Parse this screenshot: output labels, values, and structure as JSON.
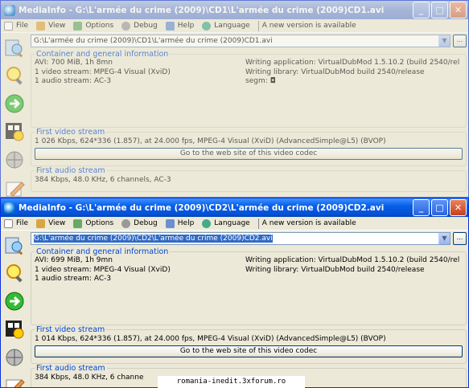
{
  "window1": {
    "title": "MediaInfo - G:\\L'armée du crime (2009)\\CD1\\L'armée du crime (2009)CD1.avi",
    "path": "G:\\L'armée du crime (2009)\\CD1\\L'armée du crime (2009)CD1.avi",
    "general": {
      "legend": "Container and general information",
      "left": [
        "AVI: 700 MiB, 1h 8mn",
        "1 video stream: MPEG-4 Visual (XviD)",
        "1 audio stream: AC-3"
      ],
      "right": [
        "Writing application: VirtualDubMod 1.5.10.2 (build 2540/rel",
        "Writing library: VirtualDubMod build 2540/release",
        "segm: ◘"
      ]
    },
    "video": {
      "legend": "First video stream",
      "line": "1 026 Kbps, 624*336 (1.857), at 24.000 fps, MPEG-4 Visual (XviD) (AdvancedSimple@L5) (BVOP)",
      "button": "Go to the web site of this video codec"
    },
    "audio": {
      "legend": "First audio stream",
      "line": "384 Kbps, 48.0 KHz, 6 channels, AC-3"
    }
  },
  "window2": {
    "title": "MediaInfo - G:\\L'armée du crime (2009)\\CD2\\L'armée du crime (2009)CD2.avi",
    "path": "G:\\L'armée du crime (2009)\\CD2\\L'armée du crime (2009)CD2.avi",
    "general": {
      "legend": "Container and general information",
      "left": [
        "AVI: 699 MiB, 1h 9mn",
        "1 video stream: MPEG-4 Visual (XviD)",
        "1 audio stream: AC-3"
      ],
      "right": [
        "Writing application: VirtualDubMod 1.5.10.2 (build 2540/rel",
        "Writing library: VirtualDubMod build 2540/release"
      ]
    },
    "video": {
      "legend": "First video stream",
      "line": "1 014 Kbps, 624*336 (1.857), at 24.000 fps, MPEG-4 Visual (XviD) (AdvancedSimple@L5) (BVOP)",
      "button": "Go to the web site of this video codec"
    },
    "audio": {
      "legend": "First audio stream",
      "line": "384 Kbps, 48.0 KHz, 6 channe"
    }
  },
  "menu": {
    "file": "File",
    "view": "View",
    "options": "Options",
    "debug": "Debug",
    "help": "Help",
    "language": "Language",
    "new_version": "A new version is available"
  },
  "titlebar_buttons": {
    "minimize": "_",
    "maximize": "□",
    "close": "✕"
  },
  "browse_label": "...",
  "watermark": "romania-inedit.3xforum.ro",
  "icons": [
    "media-info-app-icon",
    "open-file-icon",
    "magnifier-icon",
    "next-arrow-icon",
    "film-gear-icon",
    "network-icon",
    "edit-icon"
  ]
}
